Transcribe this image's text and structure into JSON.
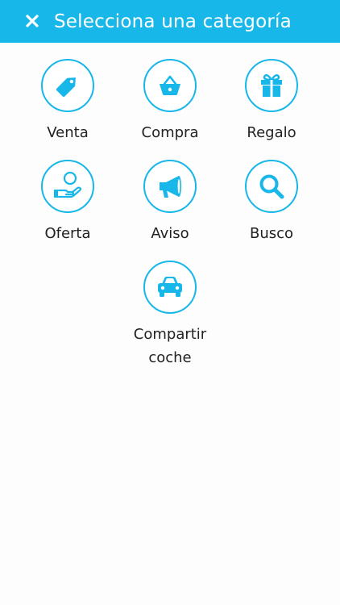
{
  "header": {
    "title": "Selecciona una categoría",
    "close_icon": "close-icon",
    "background_color": "#18b7ea"
  },
  "categories": [
    {
      "label": "Venta",
      "icon": "price-tag-icon"
    },
    {
      "label": "Compra",
      "icon": "shopping-basket-icon"
    },
    {
      "label": "Regalo",
      "icon": "gift-icon"
    },
    {
      "label": "Oferta",
      "icon": "offer-hand-icon"
    },
    {
      "label": "Aviso",
      "icon": "megaphone-icon"
    },
    {
      "label": "Busco",
      "icon": "search-icon"
    },
    {
      "label": "Compartir coche",
      "icon": "car-icon"
    }
  ],
  "colors": {
    "accent": "#18b7ea",
    "label_text": "#222222",
    "background": "#fdfdfd"
  }
}
